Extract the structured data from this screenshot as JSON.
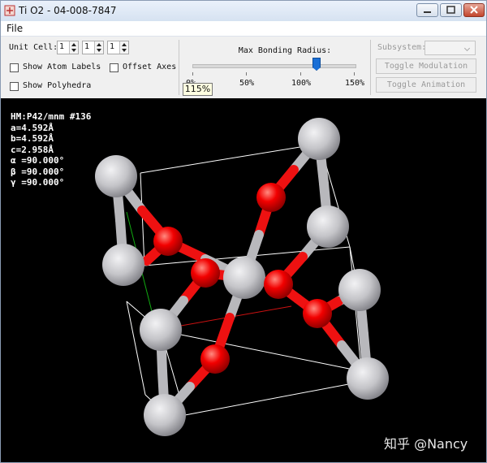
{
  "window": {
    "title": "Ti O2 - 04-008-7847"
  },
  "menu": {
    "file": "File"
  },
  "toolbar": {
    "unit_cell": {
      "label": "Unit Cell:",
      "a": "1",
      "b": "1",
      "c": "1"
    },
    "show_atom_labels": {
      "label": "Show Atom Labels",
      "checked": false
    },
    "offset_axes": {
      "label": "Offset Axes",
      "checked": false
    },
    "show_polyhedra": {
      "label": "Show Polyhedra",
      "checked": false
    },
    "bonding": {
      "label": "Max Bonding Radius:",
      "ticks": [
        "0%",
        "50%",
        "100%",
        "150%"
      ],
      "value_percent": 115,
      "tooltip": "115%"
    },
    "subsystem": {
      "label": "Subsystem:",
      "value": ""
    },
    "toggle_modulation": "Toggle Modulation",
    "toggle_animation": "Toggle Animation"
  },
  "viewer": {
    "info": [
      "HM:P42/mnm #136",
      "a=4.592Å",
      "b=4.592Å",
      "c=2.958Å",
      "α =90.000°",
      "β =90.000°",
      "γ =90.000°"
    ],
    "watermark": "知乎 @Nancy",
    "colors": {
      "titanium": "#c8c8cc",
      "oxygen": "#ff0d0d",
      "bond_ti": "#b8b8bc",
      "bond_o": "#ee1111",
      "cell": "#ffffff",
      "axis_a": "#cc1111",
      "axis_b": "#11aa11"
    }
  }
}
